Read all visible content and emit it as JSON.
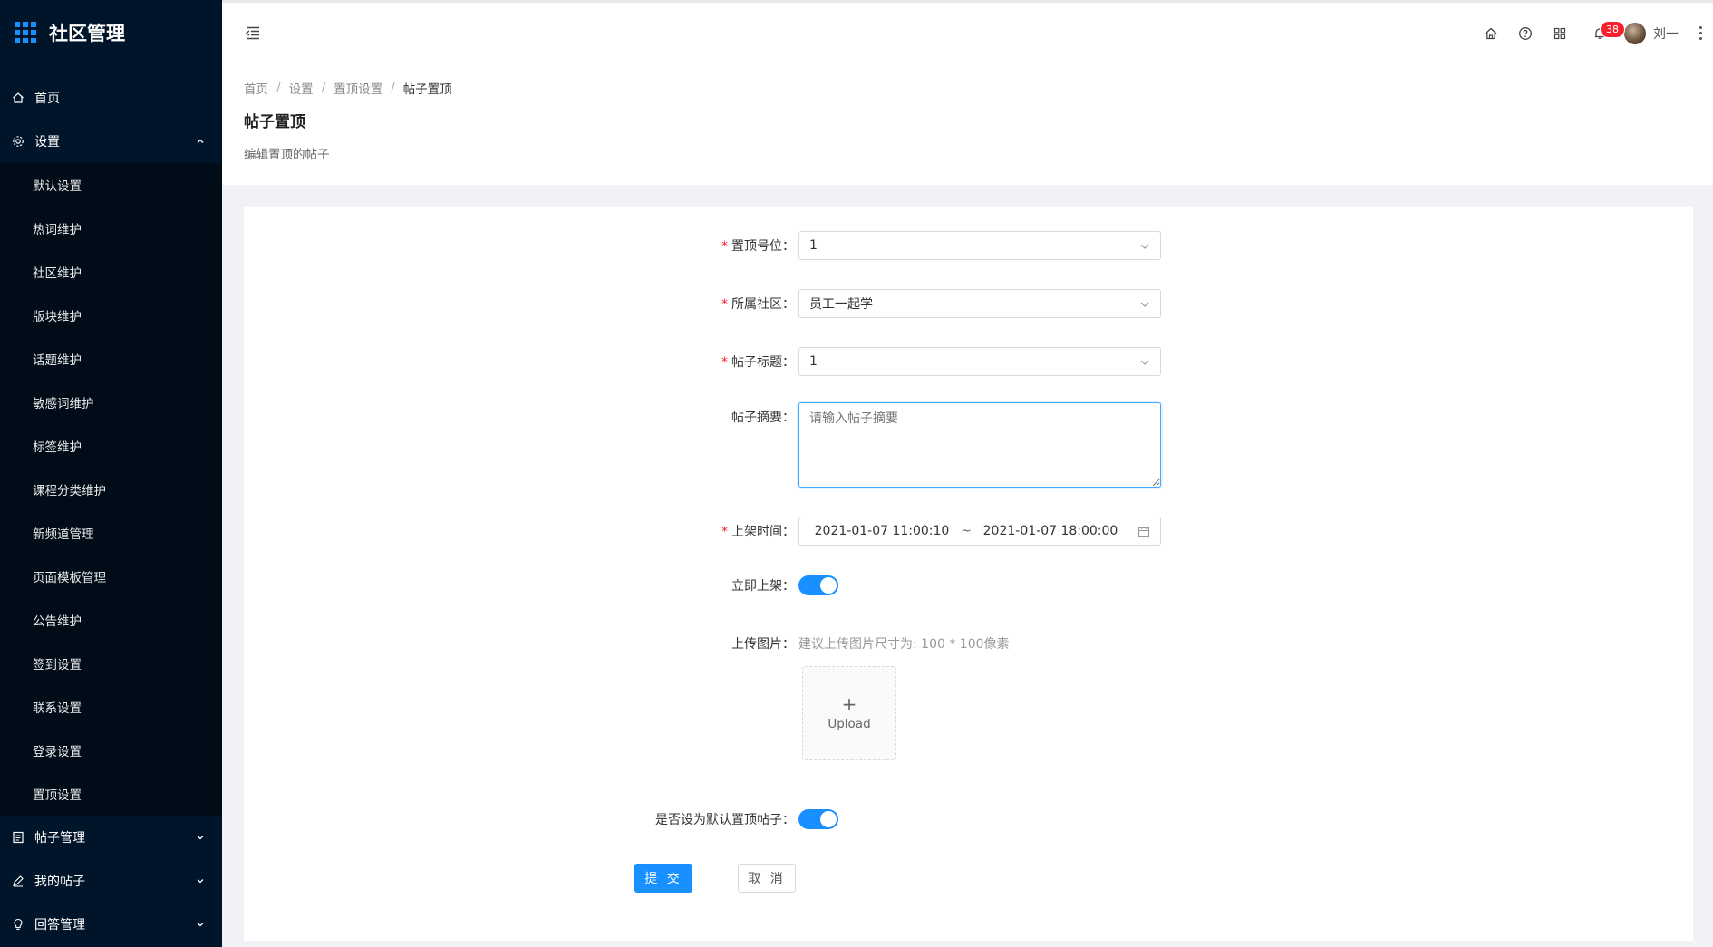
{
  "app": {
    "title": "社区管理"
  },
  "sidebar": {
    "items_top": [
      {
        "label": "首页",
        "icon": "home-icon"
      },
      {
        "label": "设置",
        "icon": "gear-icon",
        "expanded": true
      }
    ],
    "settings_sub": [
      "默认设置",
      "热词维护",
      "社区维护",
      "版块维护",
      "话题维护",
      "敏感词维护",
      "标签维护",
      "课程分类维护",
      "新频道管理",
      "页面模板管理",
      "公告维护",
      "签到设置",
      "联系设置",
      "登录设置",
      "置顶设置"
    ],
    "items_bottom": [
      {
        "label": "帖子管理",
        "icon": "document-icon"
      },
      {
        "label": "我的帖子",
        "icon": "edit-icon"
      },
      {
        "label": "回答管理",
        "icon": "bulb-icon"
      }
    ]
  },
  "header": {
    "notification_count": "38",
    "user_name": "刘一"
  },
  "page": {
    "breadcrumb": [
      "首页",
      "设置",
      "置顶设置",
      "帖子置顶"
    ],
    "title": "帖子置顶",
    "description": "编辑置顶的帖子"
  },
  "form": {
    "position": {
      "label": "置顶号位：",
      "value": "1"
    },
    "community": {
      "label": "所属社区：",
      "value": "员工一起学"
    },
    "post_title": {
      "label": "帖子标题：",
      "value": "1"
    },
    "summary": {
      "label": "帖子摘要：",
      "placeholder": "请输入帖子摘要"
    },
    "shelf_time": {
      "label": "上架时间：",
      "start": "2021-01-07 11:00:10",
      "separator": "~",
      "end": "2021-01-07 18:00:00"
    },
    "immediate": {
      "label": "立即上架：",
      "on": true
    },
    "upload": {
      "label": "上传图片：",
      "hint": "建议上传图片尺寸为: 100 * 100像素",
      "plus": "+",
      "button_text": "Upload"
    },
    "default_top": {
      "label": "是否设为默认置顶帖子：",
      "on": true
    },
    "submit_label": "提 交",
    "cancel_label": "取 消"
  },
  "colors": {
    "sidebar_bg": "#001529",
    "submenu_bg": "#000c17",
    "primary": "#1890ff",
    "required": "#f5222d"
  }
}
